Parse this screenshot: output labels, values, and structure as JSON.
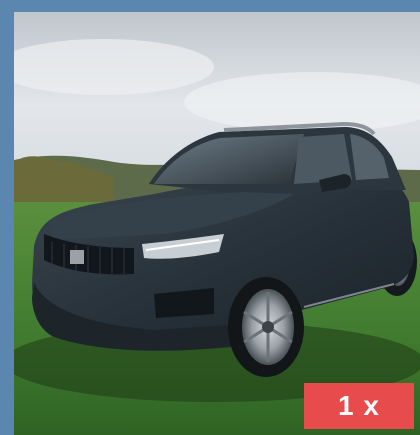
{
  "photo": {
    "subject": "car-photo",
    "colors": {
      "frame": "#5b86b0",
      "sky": "#d9dee3",
      "grass": "#3f7a2f",
      "car": "#263038",
      "badge": "#e84b4b"
    }
  },
  "badge": {
    "label": "1 x"
  }
}
